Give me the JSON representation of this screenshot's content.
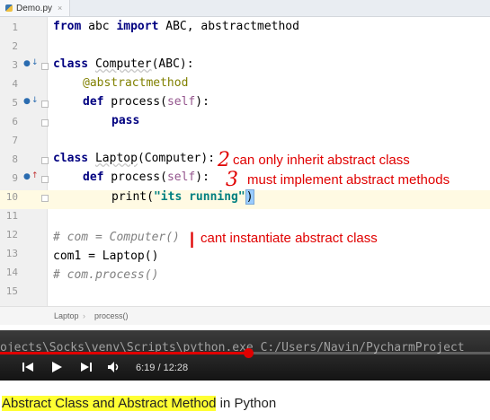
{
  "editor": {
    "tab_label": "Demo.py",
    "tab_close": "×",
    "code_lines": [
      {
        "n": "1"
      },
      {
        "n": "2"
      },
      {
        "n": "3"
      },
      {
        "n": "4"
      },
      {
        "n": "5"
      },
      {
        "n": "6"
      },
      {
        "n": "7"
      },
      {
        "n": "8"
      },
      {
        "n": "9"
      },
      {
        "n": "10"
      },
      {
        "n": "11"
      },
      {
        "n": "12"
      },
      {
        "n": "13"
      },
      {
        "n": "14"
      },
      {
        "n": "15"
      }
    ],
    "breadcrumb": [
      "Laptop",
      "process()"
    ]
  },
  "tokens": {
    "l1_from": "from",
    "l1_mid": " abc ",
    "l1_import": "import",
    "l1_rest": " ABC, abstractmethod",
    "l3_class": "class",
    "l3_name": "Computer",
    "l3_rest": "(ABC):",
    "l4_dec": "@abstractmethod",
    "l5_def": "def",
    "l5_name": " process(",
    "l5_self": "self",
    "l5_end": "):",
    "l6_pass": "pass",
    "l8_class": "class",
    "l8_name": "Laptop",
    "l8_rest": "(Computer):",
    "l9_def": "def",
    "l9_name": " process(",
    "l9_self": "self",
    "l9_end": "):",
    "l10_print": "print(",
    "l10_str": "\"its running\"",
    "l10_end": ")",
    "l12_comment": "# com = Computer()",
    "l13_code": "com1 = Laptop()",
    "l14_comment": "# com.process()"
  },
  "annotations": {
    "mark2": "2",
    "note2": "can only inherit abstract class",
    "mark3": "3",
    "note3": "must implement abstract methods",
    "mark1": "|",
    "note1": "cant instantiate abstract class"
  },
  "player": {
    "terminal_text": "ojects\\Socks\\venv\\Scripts\\python.exe C:/Users/Navin/PycharmProject",
    "current_time": "6:19",
    "duration": "12:28",
    "time_display": "6:19 / 12:28",
    "progress_fraction": 0.507,
    "accent_color": "#e00000"
  },
  "caption": {
    "highlight": "Abstract Class and Abstract Method",
    "rest": " in Python"
  }
}
